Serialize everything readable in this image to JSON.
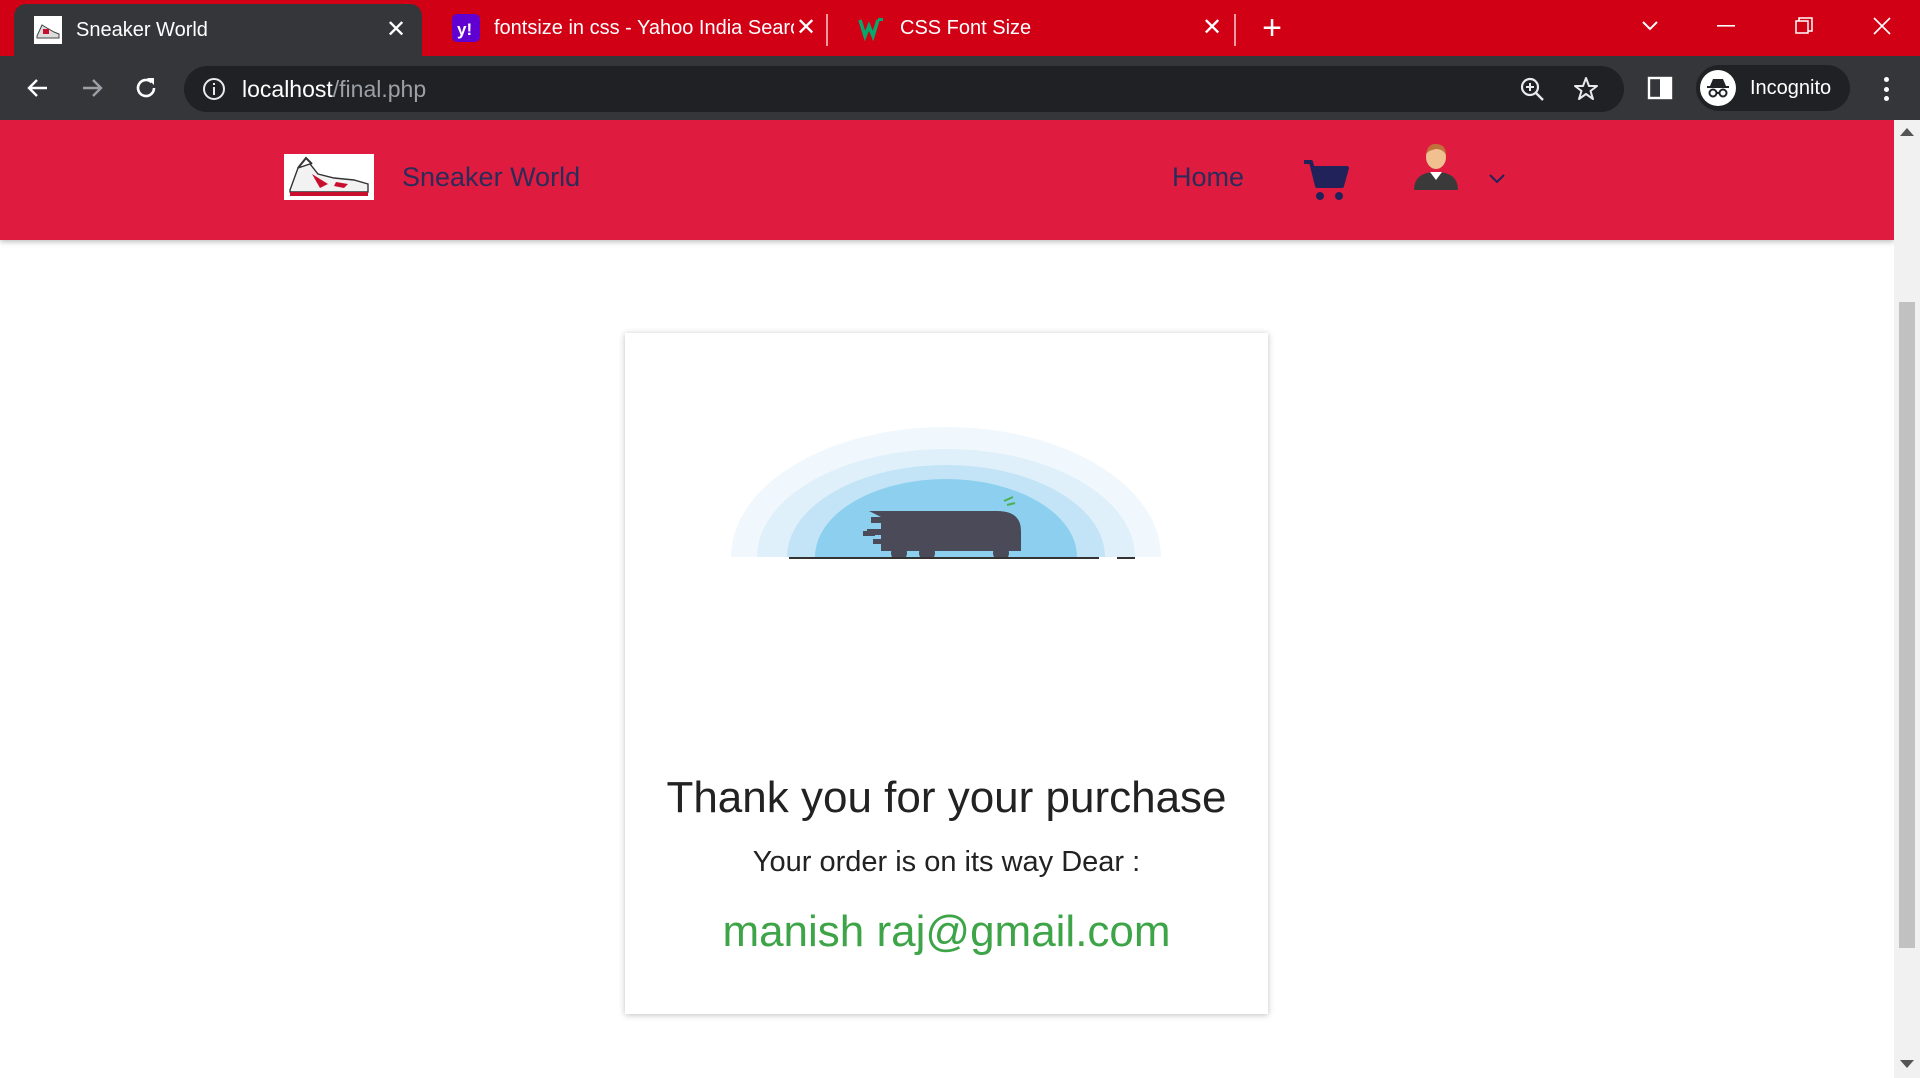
{
  "browser": {
    "tabs": [
      {
        "title": "Sneaker World",
        "favicon": "sneaker-favicon",
        "active": true
      },
      {
        "title": "fontsize in css - Yahoo India Search",
        "favicon": "yahoo-favicon",
        "active": false
      },
      {
        "title": "CSS Font Size",
        "favicon": "w3schools-favicon",
        "active": false
      }
    ],
    "url_host": "localhost",
    "url_path": "/final.php",
    "incognito_label": "Incognito",
    "accent": "#d10014"
  },
  "site": {
    "brand": "Sneaker World",
    "nav": {
      "home": "Home"
    },
    "nav_color": "#e01b40"
  },
  "confirmation": {
    "heading": "Thank you for your purchase",
    "message": "Your order is on its way Dear :",
    "email": "manish raj@gmail.com",
    "email_color": "#3da447"
  }
}
